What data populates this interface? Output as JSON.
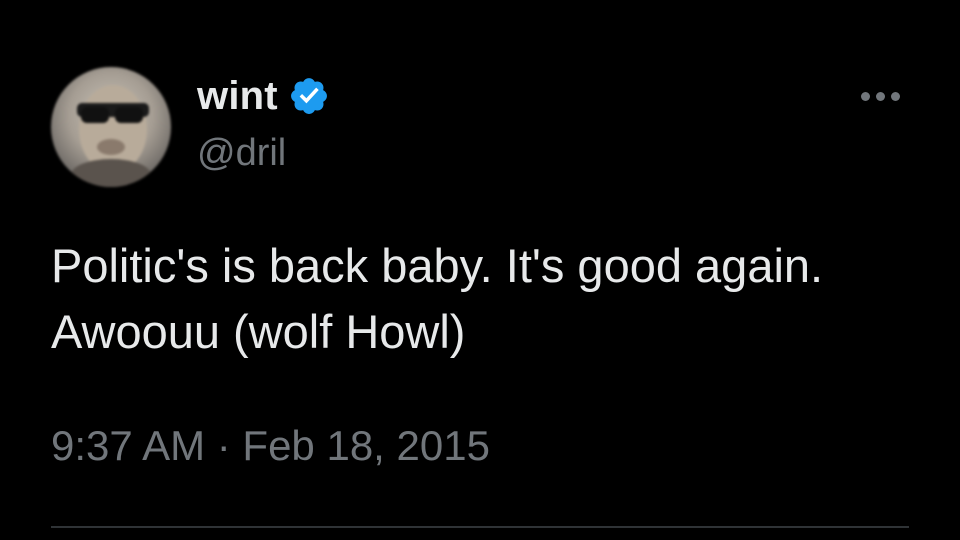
{
  "user": {
    "display_name": "wint",
    "handle": "@dril",
    "verified": true,
    "avatar": "profile-photo"
  },
  "tweet": {
    "text": "Politic's is back baby. It's good again.\nAwoouu (wolf Howl)",
    "timestamp": "9:37 AM · Feb 18, 2015"
  },
  "icons": {
    "verified": "verified-badge-icon",
    "more": "more-options-icon"
  },
  "colors": {
    "background": "#000000",
    "primary_text": "#e7e9ea",
    "secondary_text": "#71767b",
    "verified_blue": "#1d9bf0",
    "divider": "#2f3336"
  }
}
